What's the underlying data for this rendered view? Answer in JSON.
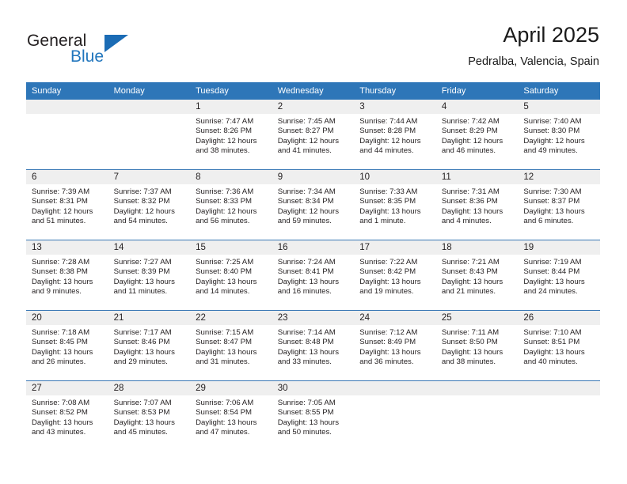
{
  "brand": {
    "line1": "General",
    "line2": "Blue",
    "triangle_icon": "brand-triangle-icon",
    "accent_color": "#2176bd"
  },
  "header": {
    "title": "April 2025",
    "subtitle": "Pedralba, Valencia, Spain"
  },
  "theme": {
    "header_blue": "#2e76b8",
    "row_rule_blue": "#3a78b5",
    "date_band_gray": "#efefef"
  },
  "calendar": {
    "weekday_headers": [
      "Sunday",
      "Monday",
      "Tuesday",
      "Wednesday",
      "Thursday",
      "Friday",
      "Saturday"
    ],
    "weeks": [
      [
        {
          "date": "",
          "empty": true
        },
        {
          "date": "",
          "empty": true
        },
        {
          "date": "1",
          "sunrise": "Sunrise: 7:47 AM",
          "sunset": "Sunset: 8:26 PM",
          "daylight_1": "Daylight: 12 hours",
          "daylight_2": "and 38 minutes."
        },
        {
          "date": "2",
          "sunrise": "Sunrise: 7:45 AM",
          "sunset": "Sunset: 8:27 PM",
          "daylight_1": "Daylight: 12 hours",
          "daylight_2": "and 41 minutes."
        },
        {
          "date": "3",
          "sunrise": "Sunrise: 7:44 AM",
          "sunset": "Sunset: 8:28 PM",
          "daylight_1": "Daylight: 12 hours",
          "daylight_2": "and 44 minutes."
        },
        {
          "date": "4",
          "sunrise": "Sunrise: 7:42 AM",
          "sunset": "Sunset: 8:29 PM",
          "daylight_1": "Daylight: 12 hours",
          "daylight_2": "and 46 minutes."
        },
        {
          "date": "5",
          "sunrise": "Sunrise: 7:40 AM",
          "sunset": "Sunset: 8:30 PM",
          "daylight_1": "Daylight: 12 hours",
          "daylight_2": "and 49 minutes."
        }
      ],
      [
        {
          "date": "6",
          "sunrise": "Sunrise: 7:39 AM",
          "sunset": "Sunset: 8:31 PM",
          "daylight_1": "Daylight: 12 hours",
          "daylight_2": "and 51 minutes."
        },
        {
          "date": "7",
          "sunrise": "Sunrise: 7:37 AM",
          "sunset": "Sunset: 8:32 PM",
          "daylight_1": "Daylight: 12 hours",
          "daylight_2": "and 54 minutes."
        },
        {
          "date": "8",
          "sunrise": "Sunrise: 7:36 AM",
          "sunset": "Sunset: 8:33 PM",
          "daylight_1": "Daylight: 12 hours",
          "daylight_2": "and 56 minutes."
        },
        {
          "date": "9",
          "sunrise": "Sunrise: 7:34 AM",
          "sunset": "Sunset: 8:34 PM",
          "daylight_1": "Daylight: 12 hours",
          "daylight_2": "and 59 minutes."
        },
        {
          "date": "10",
          "sunrise": "Sunrise: 7:33 AM",
          "sunset": "Sunset: 8:35 PM",
          "daylight_1": "Daylight: 13 hours",
          "daylight_2": "and 1 minute."
        },
        {
          "date": "11",
          "sunrise": "Sunrise: 7:31 AM",
          "sunset": "Sunset: 8:36 PM",
          "daylight_1": "Daylight: 13 hours",
          "daylight_2": "and 4 minutes."
        },
        {
          "date": "12",
          "sunrise": "Sunrise: 7:30 AM",
          "sunset": "Sunset: 8:37 PM",
          "daylight_1": "Daylight: 13 hours",
          "daylight_2": "and 6 minutes."
        }
      ],
      [
        {
          "date": "13",
          "sunrise": "Sunrise: 7:28 AM",
          "sunset": "Sunset: 8:38 PM",
          "daylight_1": "Daylight: 13 hours",
          "daylight_2": "and 9 minutes."
        },
        {
          "date": "14",
          "sunrise": "Sunrise: 7:27 AM",
          "sunset": "Sunset: 8:39 PM",
          "daylight_1": "Daylight: 13 hours",
          "daylight_2": "and 11 minutes."
        },
        {
          "date": "15",
          "sunrise": "Sunrise: 7:25 AM",
          "sunset": "Sunset: 8:40 PM",
          "daylight_1": "Daylight: 13 hours",
          "daylight_2": "and 14 minutes."
        },
        {
          "date": "16",
          "sunrise": "Sunrise: 7:24 AM",
          "sunset": "Sunset: 8:41 PM",
          "daylight_1": "Daylight: 13 hours",
          "daylight_2": "and 16 minutes."
        },
        {
          "date": "17",
          "sunrise": "Sunrise: 7:22 AM",
          "sunset": "Sunset: 8:42 PM",
          "daylight_1": "Daylight: 13 hours",
          "daylight_2": "and 19 minutes."
        },
        {
          "date": "18",
          "sunrise": "Sunrise: 7:21 AM",
          "sunset": "Sunset: 8:43 PM",
          "daylight_1": "Daylight: 13 hours",
          "daylight_2": "and 21 minutes."
        },
        {
          "date": "19",
          "sunrise": "Sunrise: 7:19 AM",
          "sunset": "Sunset: 8:44 PM",
          "daylight_1": "Daylight: 13 hours",
          "daylight_2": "and 24 minutes."
        }
      ],
      [
        {
          "date": "20",
          "sunrise": "Sunrise: 7:18 AM",
          "sunset": "Sunset: 8:45 PM",
          "daylight_1": "Daylight: 13 hours",
          "daylight_2": "and 26 minutes."
        },
        {
          "date": "21",
          "sunrise": "Sunrise: 7:17 AM",
          "sunset": "Sunset: 8:46 PM",
          "daylight_1": "Daylight: 13 hours",
          "daylight_2": "and 29 minutes."
        },
        {
          "date": "22",
          "sunrise": "Sunrise: 7:15 AM",
          "sunset": "Sunset: 8:47 PM",
          "daylight_1": "Daylight: 13 hours",
          "daylight_2": "and 31 minutes."
        },
        {
          "date": "23",
          "sunrise": "Sunrise: 7:14 AM",
          "sunset": "Sunset: 8:48 PM",
          "daylight_1": "Daylight: 13 hours",
          "daylight_2": "and 33 minutes."
        },
        {
          "date": "24",
          "sunrise": "Sunrise: 7:12 AM",
          "sunset": "Sunset: 8:49 PM",
          "daylight_1": "Daylight: 13 hours",
          "daylight_2": "and 36 minutes."
        },
        {
          "date": "25",
          "sunrise": "Sunrise: 7:11 AM",
          "sunset": "Sunset: 8:50 PM",
          "daylight_1": "Daylight: 13 hours",
          "daylight_2": "and 38 minutes."
        },
        {
          "date": "26",
          "sunrise": "Sunrise: 7:10 AM",
          "sunset": "Sunset: 8:51 PM",
          "daylight_1": "Daylight: 13 hours",
          "daylight_2": "and 40 minutes."
        }
      ],
      [
        {
          "date": "27",
          "sunrise": "Sunrise: 7:08 AM",
          "sunset": "Sunset: 8:52 PM",
          "daylight_1": "Daylight: 13 hours",
          "daylight_2": "and 43 minutes."
        },
        {
          "date": "28",
          "sunrise": "Sunrise: 7:07 AM",
          "sunset": "Sunset: 8:53 PM",
          "daylight_1": "Daylight: 13 hours",
          "daylight_2": "and 45 minutes."
        },
        {
          "date": "29",
          "sunrise": "Sunrise: 7:06 AM",
          "sunset": "Sunset: 8:54 PM",
          "daylight_1": "Daylight: 13 hours",
          "daylight_2": "and 47 minutes."
        },
        {
          "date": "30",
          "sunrise": "Sunrise: 7:05 AM",
          "sunset": "Sunset: 8:55 PM",
          "daylight_1": "Daylight: 13 hours",
          "daylight_2": "and 50 minutes."
        },
        {
          "date": "",
          "empty": true
        },
        {
          "date": "",
          "empty": true
        },
        {
          "date": "",
          "empty": true
        }
      ]
    ]
  }
}
